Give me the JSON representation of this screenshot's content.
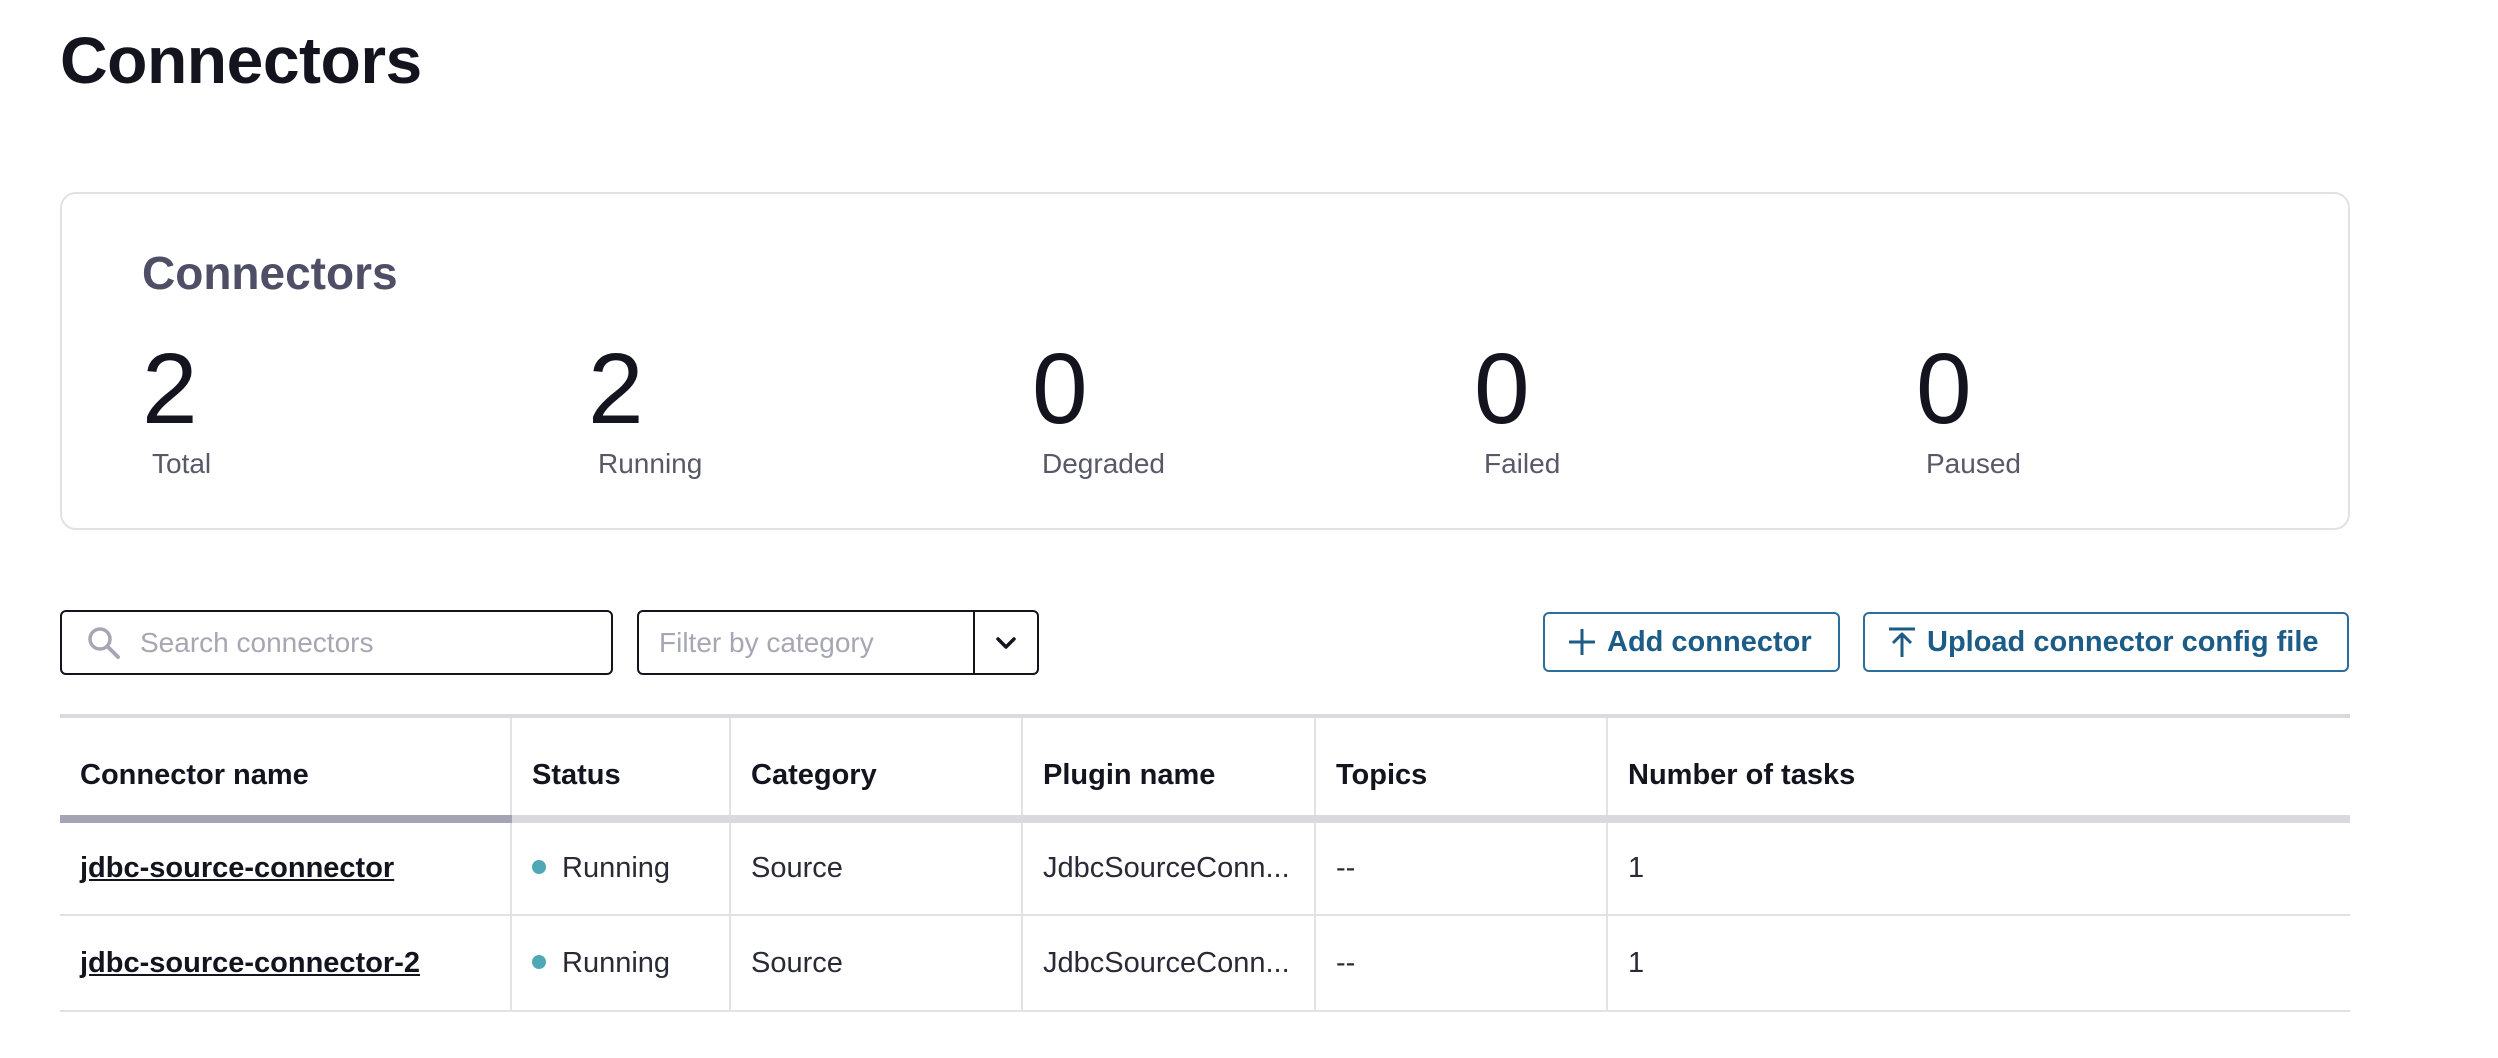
{
  "page": {
    "title": "Connectors"
  },
  "summary": {
    "title": "Connectors",
    "stats": [
      {
        "value": "2",
        "label": "Total"
      },
      {
        "value": "2",
        "label": "Running"
      },
      {
        "value": "0",
        "label": "Degraded"
      },
      {
        "value": "0",
        "label": "Failed"
      },
      {
        "value": "0",
        "label": "Paused"
      }
    ]
  },
  "toolbar": {
    "search_placeholder": "Search connectors",
    "search_icon": "search-icon",
    "filter_placeholder": "Filter by category",
    "filter_icon": "chevron-down-icon",
    "add_label": "Add connector",
    "add_icon": "plus-icon",
    "upload_label": "Upload connector config file",
    "upload_icon": "upload-icon"
  },
  "table": {
    "columns": [
      "Connector name",
      "Status",
      "Category",
      "Plugin name",
      "Topics",
      "Number of tasks"
    ],
    "rows": [
      {
        "name": "jdbc-source-connector",
        "status": "Running",
        "category": "Source",
        "plugin": "JdbcSourceConn...",
        "topics": "--",
        "tasks": "1"
      },
      {
        "name": "jdbc-source-connector-2",
        "status": "Running",
        "category": "Source",
        "plugin": "JdbcSourceConn...",
        "topics": "--",
        "tasks": "1"
      }
    ]
  },
  "colors": {
    "running_dot": "#4ea8b5",
    "button_accent": "#1c5c87"
  }
}
